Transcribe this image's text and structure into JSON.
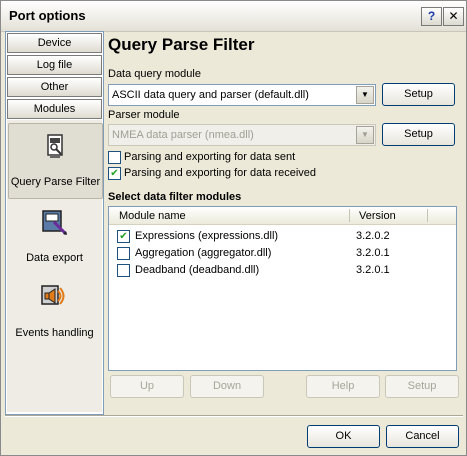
{
  "window": {
    "title": "Port options",
    "help_btn": "?",
    "close_btn": "✕"
  },
  "nav": {
    "tabs": [
      "Device",
      "Log file",
      "Other",
      "Modules"
    ],
    "items": [
      {
        "label": "Query Parse Filter",
        "icon": "query-parse-filter-icon",
        "selected": true
      },
      {
        "label": "Data export",
        "icon": "data-export-icon",
        "selected": false
      },
      {
        "label": "Events handling",
        "icon": "events-handling-icon",
        "selected": false
      }
    ]
  },
  "main": {
    "heading": "Query Parse Filter",
    "query_label": "Data query module",
    "query_value": "ASCII data query and parser (default.dll)",
    "parser_label": "Parser module",
    "parser_value": "NMEA data parser (nmea.dll)",
    "setup": "Setup",
    "check_sent": "Parsing and exporting for data sent",
    "check_received": "Parsing and exporting for data received",
    "filter_title": "Select data filter modules",
    "list": {
      "columns": [
        "Module name",
        "Version"
      ],
      "rows": [
        {
          "name": "Expressions (expressions.dll)",
          "version": "3.2.0.2",
          "checked": true
        },
        {
          "name": "Aggregation (aggregator.dll)",
          "version": "3.2.0.1",
          "checked": false
        },
        {
          "name": "Deadband (deadband.dll)",
          "version": "3.2.0.1",
          "checked": false
        }
      ]
    },
    "buttons": {
      "up": "Up",
      "down": "Down",
      "help": "Help",
      "setup": "Setup"
    }
  },
  "footer": {
    "ok": "OK",
    "cancel": "Cancel"
  },
  "check_mark": "✔",
  "combo_arrow": "▼",
  "colors": {
    "accent": "#003c74",
    "check": "#21a121"
  }
}
